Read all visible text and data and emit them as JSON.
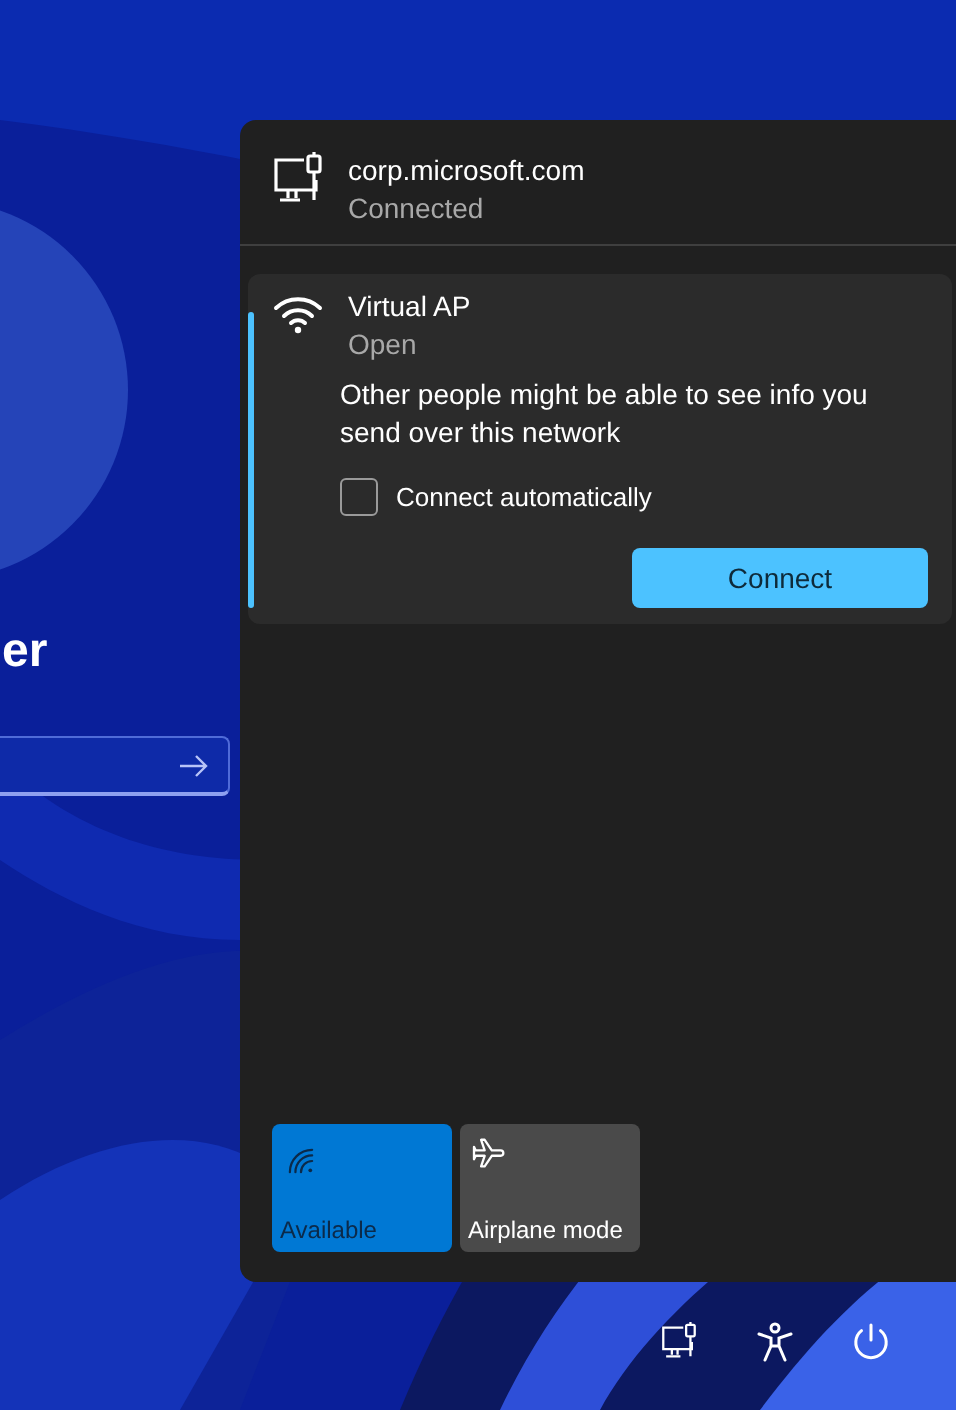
{
  "lock_screen": {
    "user_name": "er"
  },
  "wired": {
    "name": "corp.microsoft.com",
    "status": "Connected"
  },
  "networks": [
    {
      "name": "Virtual AP",
      "status": "Open",
      "selected": true,
      "warning": "Other people might be able to see info you send over this network",
      "auto_connect": {
        "label": "Connect automatically",
        "checked": false
      },
      "button": "Connect"
    }
  ],
  "quick_tiles": [
    {
      "kind": "wifi",
      "label": "Available",
      "on": true
    },
    {
      "kind": "airplane",
      "label": "Airplane mode",
      "on": false
    }
  ],
  "footer_icons": [
    {
      "kind": "network"
    },
    {
      "kind": "accessibility"
    },
    {
      "kind": "power"
    }
  ]
}
